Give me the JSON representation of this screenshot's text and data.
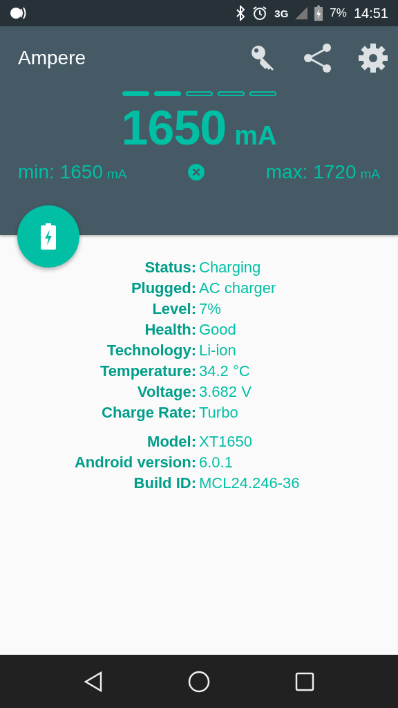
{
  "status_bar": {
    "network_type": "3G",
    "battery_percent": "7%",
    "time": "14:51"
  },
  "app_bar": {
    "title": "Ampere"
  },
  "meter": {
    "segments": [
      {
        "filled": true
      },
      {
        "filled": true
      },
      {
        "filled": false
      },
      {
        "filled": false
      },
      {
        "filled": false
      }
    ],
    "current": "1650",
    "unit": "mA",
    "min_label": "min:",
    "min_value": "1650",
    "min_unit": "mA",
    "max_label": "max:",
    "max_value": "1720",
    "max_unit": "mA"
  },
  "info_groups": [
    [
      {
        "label": "Status:",
        "value": "Charging"
      },
      {
        "label": "Plugged:",
        "value": "AC charger"
      },
      {
        "label": "Level:",
        "value": "7%"
      },
      {
        "label": "Health:",
        "value": "Good"
      },
      {
        "label": "Technology:",
        "value": "Li-ion"
      },
      {
        "label": "Temperature:",
        "value": "34.2 °C"
      },
      {
        "label": "Voltage:",
        "value": "3.682 V"
      },
      {
        "label": "Charge Rate:",
        "value": "Turbo"
      }
    ],
    [
      {
        "label": "Model:",
        "value": "XT1650"
      },
      {
        "label": "Android version:",
        "value": "6.0.1"
      },
      {
        "label": "Build ID:",
        "value": "MCL24.246-36"
      }
    ]
  ]
}
